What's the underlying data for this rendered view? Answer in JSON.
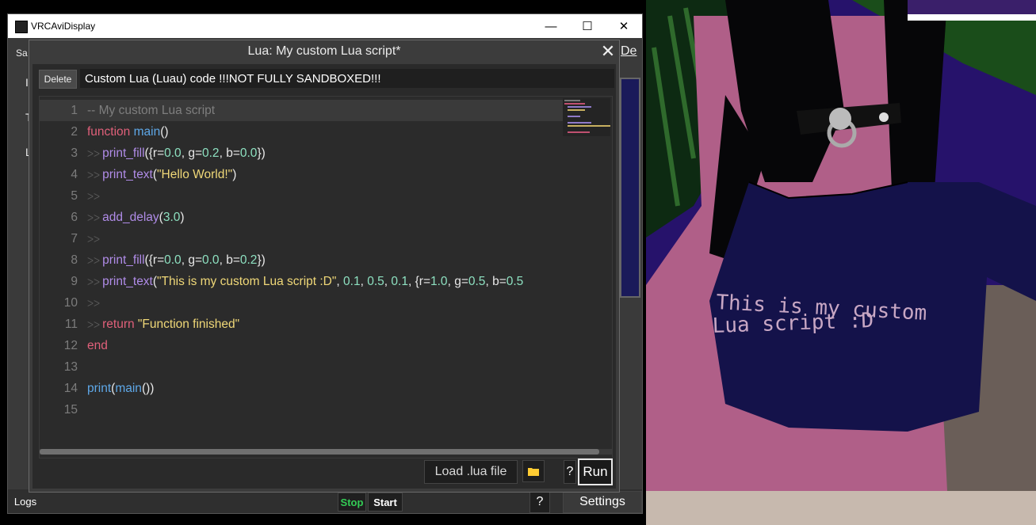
{
  "window": {
    "title": "VRCAviDisplay",
    "minimize": "—",
    "maximize": "☐",
    "close": "✕"
  },
  "background_app": {
    "left_fragment_1": "Sa",
    "left_fragment_2": "I",
    "left_fragment_3": "T",
    "left_fragment_4": "L",
    "right_fragment": "De"
  },
  "dialog": {
    "title": "Lua:  My custom Lua script*",
    "close": "✕",
    "delete_label": "Delete",
    "header": "Custom Lua (Luau) code !!!NOT FULLY SANDBOXED!!!",
    "load_label": "Load .lua file",
    "folder_icon": "folder-icon",
    "help_label": "?",
    "run_label": "Run"
  },
  "code_lines": [
    {
      "n": "1",
      "text": "-- My custom Lua script"
    },
    {
      "n": "2",
      "text": "function main()"
    },
    {
      "n": "3",
      "text": "print_fill({r=0.0, g=0.2, b=0.0})"
    },
    {
      "n": "4",
      "text": "print_text(\"Hello World!\")"
    },
    {
      "n": "5",
      "text": ""
    },
    {
      "n": "6",
      "text": "add_delay(3.0)"
    },
    {
      "n": "7",
      "text": ""
    },
    {
      "n": "8",
      "text": "print_fill({r=0.0, g=0.0, b=0.2})"
    },
    {
      "n": "9",
      "text": "print_text(\"This is my custom Lua script :D\", 0.1, 0.5, 0.1, {r=1.0, g=0.5, b=0.5"
    },
    {
      "n": "10",
      "text": ""
    },
    {
      "n": "11",
      "text": "return \"Function finished\""
    },
    {
      "n": "12",
      "text": "end"
    },
    {
      "n": "13",
      "text": ""
    },
    {
      "n": "14",
      "text": "print(main())"
    },
    {
      "n": "15",
      "text": ""
    }
  ],
  "bottom_bar": {
    "logs": "Logs",
    "stop": "Stop",
    "start": "Start",
    "help": "?",
    "settings": "Settings"
  },
  "scene": {
    "shirt_text_line1": "This is my custom",
    "shirt_text_line2": "Lua script :D"
  },
  "colors": {
    "keyword": "#e0607a",
    "function_name": "#5ea8e8",
    "call": "#b08ce8",
    "string": "#f0d878",
    "number": "#8de0c0",
    "stop_green": "#33cc55"
  }
}
